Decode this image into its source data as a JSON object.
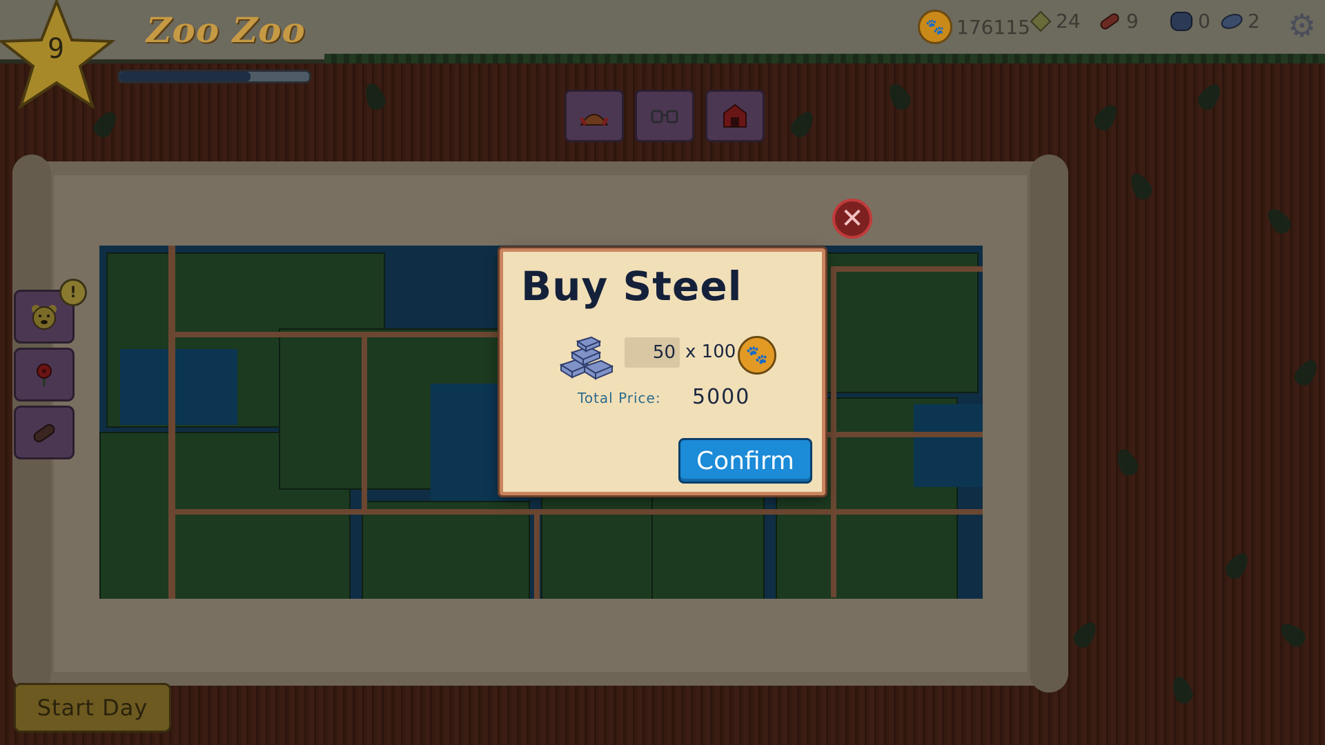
{
  "game_title": "Zoo Zoo",
  "level": "9",
  "xp_progress": 0.69,
  "resources": [
    {
      "icon": "paw-coin-icon",
      "value": "176115"
    },
    {
      "icon": "gem-icon",
      "value": "24"
    },
    {
      "icon": "wood-log-icon",
      "value": "9"
    },
    {
      "icon": "stone-icon",
      "value": "0"
    },
    {
      "icon": "steel-icon",
      "value": "2"
    }
  ],
  "toolbar": [
    {
      "icon": "animal-icon"
    },
    {
      "icon": "binoculars-icon"
    },
    {
      "icon": "barn-icon"
    }
  ],
  "side_buttons": [
    {
      "icon": "bear-face-icon",
      "alert": "!"
    },
    {
      "icon": "flower-icon"
    },
    {
      "icon": "log-icon"
    }
  ],
  "start_day_label": "Start Day",
  "modal": {
    "title": "Buy Steel",
    "quantity": "50",
    "multiplier": "x 100",
    "total_label": "Total Price:",
    "total_value": "5000",
    "confirm_label": "Confirm"
  },
  "colors": {
    "confirm_blue": "#1c8bd8",
    "modal_bg": "#f1dfb8",
    "close_red": "#c13b3b"
  }
}
